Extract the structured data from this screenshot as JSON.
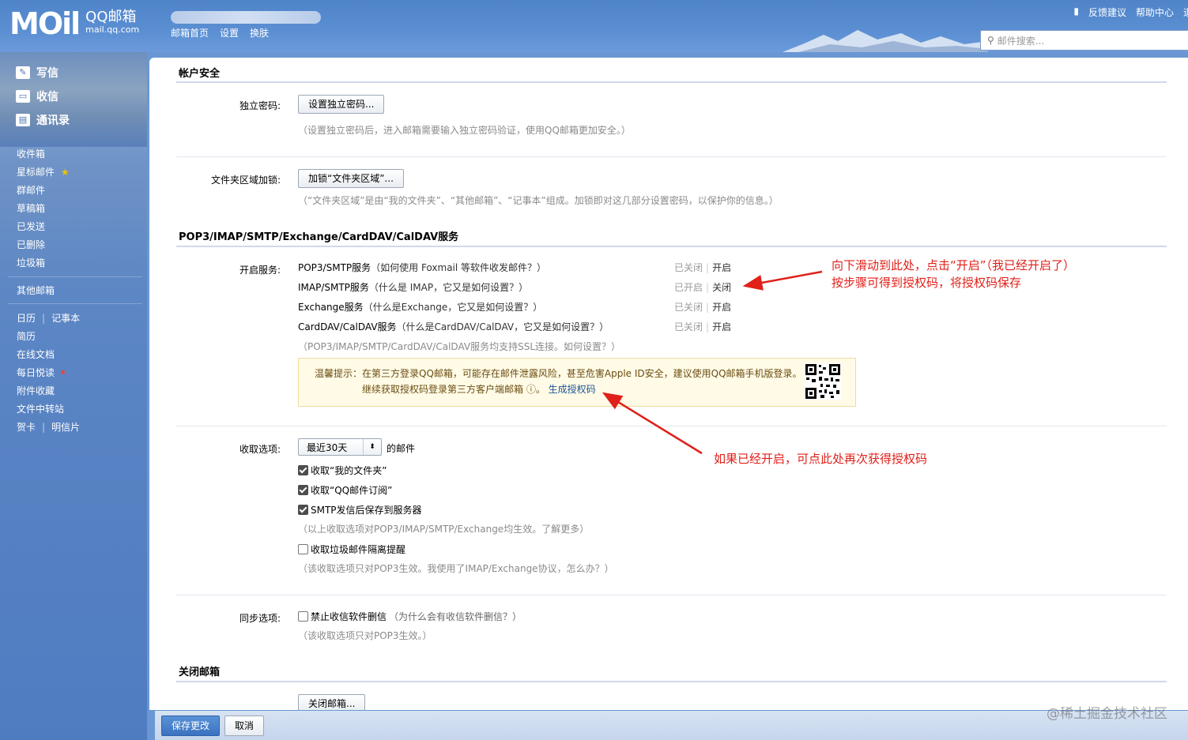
{
  "header": {
    "logo_mark": "MOil",
    "logo_title": "QQ邮箱",
    "logo_sub": "mail.qq.com",
    "nav": [
      "邮箱首页",
      "设置",
      "换肤"
    ],
    "links": [
      "反馈建议",
      "帮助中心",
      "退"
    ],
    "search_placeholder": "邮件搜索..."
  },
  "sidebar": {
    "big": [
      "写信",
      "收信",
      "通讯录"
    ],
    "folders": [
      "收件箱",
      "星标邮件",
      "群邮件",
      "草稿箱",
      "已发送",
      "已删除",
      "垃圾箱"
    ],
    "other": "其他邮箱",
    "apps": {
      "calendar": "日历",
      "notes": "记事本",
      "resume": "简历",
      "docs": "在线文档",
      "daily": "每日悦读",
      "attach": "附件收藏",
      "transfer": "文件中转站",
      "card": "贺卡",
      "postcard": "明信片"
    }
  },
  "account_security": {
    "title": "帐户安全",
    "pwd_label": "独立密码:",
    "pwd_button": "设置独立密码...",
    "pwd_hint": "（设置独立密码后，进入邮箱需要输入独立密码验证，使用QQ邮箱更加安全。）",
    "folder_label": "文件夹区域加锁:",
    "folder_button": "加锁“文件夹区域”...",
    "folder_hint": "（“文件夹区域”是由“我的文件夹”、“其他邮箱”、“记事本”组成。加锁即对这几部分设置密码，以保护你的信息。）"
  },
  "services": {
    "title": "POP3/IMAP/SMTP/Exchange/CardDAV/CalDAV服务",
    "label": "开启服务:",
    "items": [
      {
        "name": "POP3/SMTP服务",
        "q": "（如何使用 Foxmail 等软件收发邮件？）",
        "status": "已关闭",
        "action": "开启"
      },
      {
        "name": "IMAP/SMTP服务",
        "q": "（什么是 IMAP，它又是如何设置？）",
        "status": "已开启",
        "action": "关闭"
      },
      {
        "name": "Exchange服务",
        "q": "（什么是Exchange，它又是如何设置？）",
        "status": "已关闭",
        "action": "开启"
      },
      {
        "name": "CardDAV/CalDAV服务",
        "q": "（什么是CardDAV/CalDAV，它又是如何设置？）",
        "status": "已关闭",
        "action": "开启"
      }
    ],
    "ssl_hint": "（POP3/IMAP/SMTP/CardDAV/CalDAV服务均支持SSL连接。如何设置？）",
    "tip_line1": "温馨提示：在第三方登录QQ邮箱，可能存在邮件泄露风险，甚至危害Apple ID安全，建议使用QQ邮箱手机版登录。",
    "tip_line2": "继续获取授权码登录第三方客户端邮箱 ⓘ。",
    "tip_link": "生成授权码"
  },
  "receive": {
    "label": "收取选项:",
    "select_value": "最近30天",
    "select_suffix": "的邮件",
    "checks": [
      {
        "label": "收取“我的文件夹”",
        "checked": true
      },
      {
        "label": "收取“QQ邮件订阅”",
        "checked": true
      },
      {
        "label": "SMTP发信后保存到服务器",
        "checked": true
      }
    ],
    "hint1": "（以上收取选项对POP3/IMAP/SMTP/Exchange均生效。了解更多）",
    "spam_label": "收取垃圾邮件隔离提醒",
    "spam_checked": false,
    "hint2": "（该收取选项只对POP3生效。我使用了IMAP/Exchange协议，怎么办？）"
  },
  "sync": {
    "label": "同步选项:",
    "check_label": "禁止收信软件删信",
    "check_q": "（为什么会有收信软件删信？）",
    "hint": "（该收取选项只对POP3生效。）"
  },
  "close_mail": {
    "title": "关闭邮箱",
    "button": "关闭邮箱..."
  },
  "bottom": {
    "save": "保存更改",
    "cancel": "取消"
  },
  "annotations": {
    "a1_line1": "向下滑动到此处，点击“开启”（我已经开启了）",
    "a1_line2": "按步骤可得到授权码，将授权码保存",
    "a2": "如果已经开启，可点此处再次获得授权码",
    "color": "#e0201a"
  },
  "watermark": "@稀土掘金技术社区"
}
